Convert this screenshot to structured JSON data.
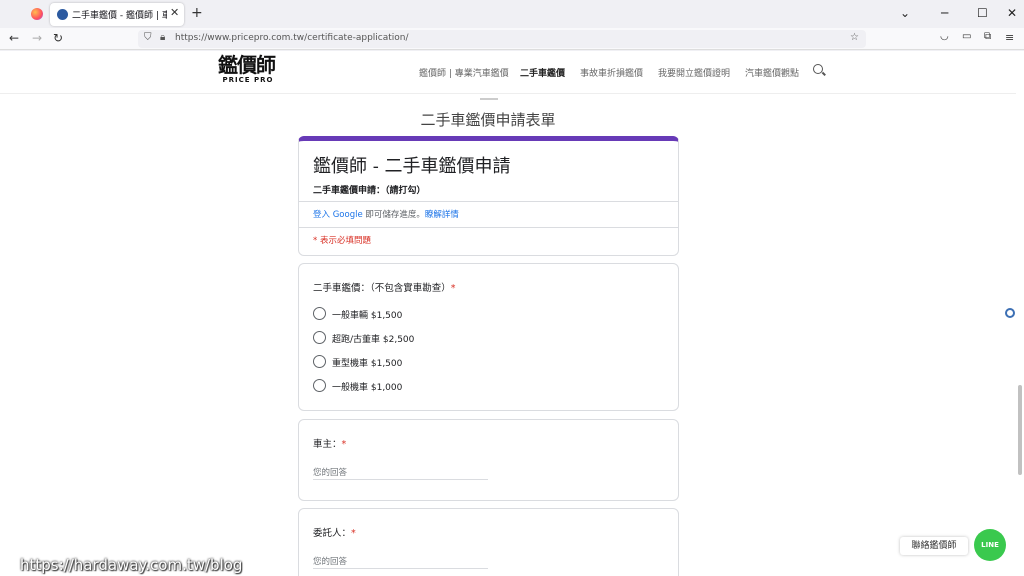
{
  "browser": {
    "tab_title": "二手車鑑價 - 鑑價師 | 車價諮詢",
    "new_tab": "+",
    "tab_close": "✕",
    "url": "https://www.pricepro.com.tw/certificate-application/",
    "win_min": "─",
    "win_max": "☐",
    "win_close": "✕",
    "back": "←",
    "forward": "→",
    "reload": "↻",
    "expand": "⌄"
  },
  "site": {
    "logo_main": "鑑價師",
    "logo_sub": "PRICE PRO",
    "menu": [
      "鑑價師 | 專業汽車鑑價",
      "二手車鑑價",
      "事故車折損鑑價",
      "我要開立鑑價證明",
      "汽車鑑價觀點"
    ],
    "active_menu_index": 1,
    "page_heading": "二手車鑑價申請表單"
  },
  "form": {
    "title": "鑑價師 - 二手車鑑價申請",
    "description": "二手車鑑價申請：（請打勾）",
    "signin_prefix": "登入 Google",
    "signin_middle": " 即可儲存進度。",
    "signin_link": "瞭解詳情",
    "required_note": "* 表示必填問題",
    "q1": {
      "label": "二手車鑑價：（不包含實車勘查）",
      "required": "*",
      "options": [
        "一般車輛 $1,500",
        "超跑/古董車 $2,500",
        "重型機車 $1,500",
        "一般機車 $1,000"
      ]
    },
    "q2": {
      "label": "車主：",
      "required": "*",
      "placeholder": "您的回答"
    },
    "q3": {
      "label": "委託人：",
      "required": "*",
      "placeholder": "您的回答"
    }
  },
  "widgets": {
    "contact_label": "聯絡鑑價師",
    "line_label": "LINE"
  },
  "watermark": "https://hardaway.com.tw/blog",
  "colors": {
    "accent": "#673ab7",
    "required": "#d93025",
    "link": "#1a73e8",
    "line_green": "#3ac94e"
  }
}
